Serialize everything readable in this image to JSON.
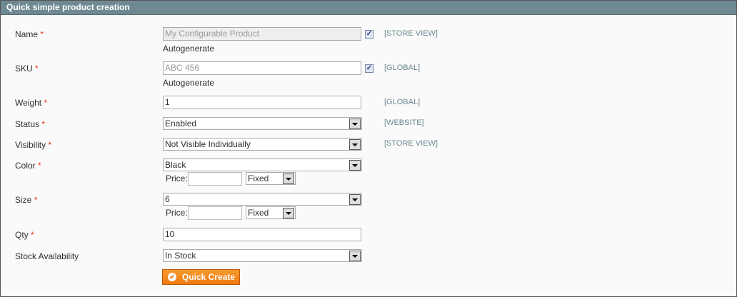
{
  "header": {
    "title": "Quick simple product creation"
  },
  "fields": {
    "name": {
      "label": "Name",
      "value": "My Configurable Product",
      "autogenerate": "Autogenerate",
      "checked": true,
      "scope": "[STORE VIEW]"
    },
    "sku": {
      "label": "SKU",
      "value": "ABC 456",
      "autogenerate": "Autogenerate",
      "checked": true,
      "scope": "[GLOBAL]"
    },
    "weight": {
      "label": "Weight",
      "value": "1",
      "scope": "[GLOBAL]"
    },
    "status": {
      "label": "Status",
      "value": "Enabled",
      "scope": "[WEBSITE]"
    },
    "visibility": {
      "label": "Visibility",
      "value": "Not Visible Individually",
      "scope": "[STORE VIEW]"
    },
    "color": {
      "label": "Color",
      "value": "Black",
      "price_label": "Price:",
      "price_value": "",
      "price_type": "Fixed"
    },
    "size": {
      "label": "Size",
      "value": "6",
      "price_label": "Price:",
      "price_value": "",
      "price_type": "Fixed"
    },
    "qty": {
      "label": "Qty",
      "value": "10"
    },
    "stock": {
      "label": "Stock Availability",
      "value": "In Stock"
    }
  },
  "required_mark": "*",
  "button": {
    "label": "Quick Create"
  },
  "colors": {
    "header": "#6f8992",
    "button": "#ef7a0f",
    "required": "#eb340a"
  }
}
